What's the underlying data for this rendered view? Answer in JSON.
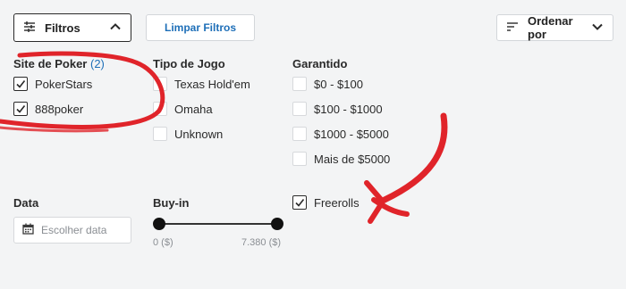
{
  "toolbar": {
    "filters_label": "Filtros",
    "clear_label": "Limpar Filtros",
    "sort_label": "Ordenar por"
  },
  "site": {
    "title": "Site de Poker",
    "count": "(2)",
    "options": [
      {
        "label": "PokerStars",
        "checked": true
      },
      {
        "label": "888poker",
        "checked": true
      }
    ]
  },
  "game_type": {
    "title": "Tipo de Jogo",
    "options": [
      {
        "label": "Texas Hold'em",
        "checked": false
      },
      {
        "label": "Omaha",
        "checked": false
      },
      {
        "label": "Unknown",
        "checked": false
      }
    ]
  },
  "guaranteed": {
    "title": "Garantido",
    "options": [
      {
        "label": "$0 - $100",
        "checked": false
      },
      {
        "label": "$100 - $1000",
        "checked": false
      },
      {
        "label": "$1000 - $5000",
        "checked": false
      },
      {
        "label": "Mais de $5000",
        "checked": false
      }
    ]
  },
  "date": {
    "title": "Data",
    "placeholder": "Escolher data"
  },
  "buyin": {
    "title": "Buy-in",
    "min_label": "0 ($)",
    "max_label": "7.380 ($)"
  },
  "freerolls": {
    "label": "Freerolls",
    "checked": true
  },
  "colors": {
    "accent": "#1e6fb8",
    "annotation": "#e0242a",
    "background": "#f3f4f5"
  }
}
